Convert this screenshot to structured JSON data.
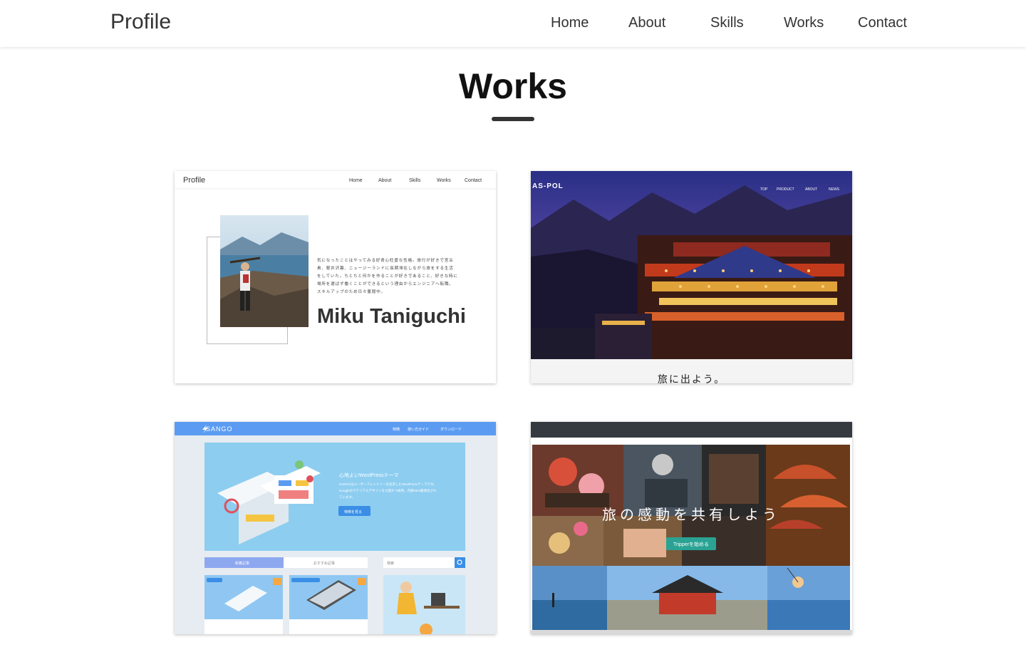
{
  "header": {
    "brand": "Profile",
    "nav": [
      "Home",
      "About",
      "Skills",
      "Works",
      "Contact"
    ]
  },
  "section": {
    "title": "Works"
  },
  "works": [
    {
      "mini_brand": "Profile",
      "mini_nav": [
        "Home",
        "About",
        "Skills",
        "Works",
        "Contact"
      ],
      "name": "Miku Taniguchi",
      "bio_lines": [
        "気になったことはやってみる好奇心旺盛な性格。旅行が好きで宮古",
        "島、軽井沢暮、ニュージーランドに長期滞在しながら旅をする生活",
        "をしていた。ちとちと何かを作ることが好きであること、好きな時に",
        "場所を選ばず働くことができるという理由からエンジニアへ転職。",
        "スキルアップのため日々奮闘中。"
      ]
    },
    {
      "logo": "AS-POL",
      "nav": [
        "TOP",
        "PRODUCT",
        "ABOUT",
        "NEWS"
      ],
      "caption": "旅に出よう。"
    },
    {
      "logo": "SANGO",
      "nav": [
        "特徴",
        "使い方ガイド",
        "ダウンロード"
      ],
      "hero_title": "心地よいWordPressテーマ",
      "hero_text": [
        "SANGOはユーザーフレンドリーを追求したWordPressテーマです。",
        "Googleのマテリアルデザインを大胆かつ採用。内部SEO最適化され",
        "ています。"
      ],
      "hero_button": "特徴を見る",
      "tabs": [
        "新着記事",
        "おすすめ記事"
      ],
      "search_placeholder": "検索"
    },
    {
      "headline": "旅の感動を共有しよう",
      "button": "Tripperを始める"
    }
  ],
  "colors": {
    "text": "#333333",
    "sango_blue": "#5b9cf2",
    "sango_hero": "#8dcdf0",
    "tripper_green": "#2aa394",
    "tripper_bar": "#343a40"
  }
}
